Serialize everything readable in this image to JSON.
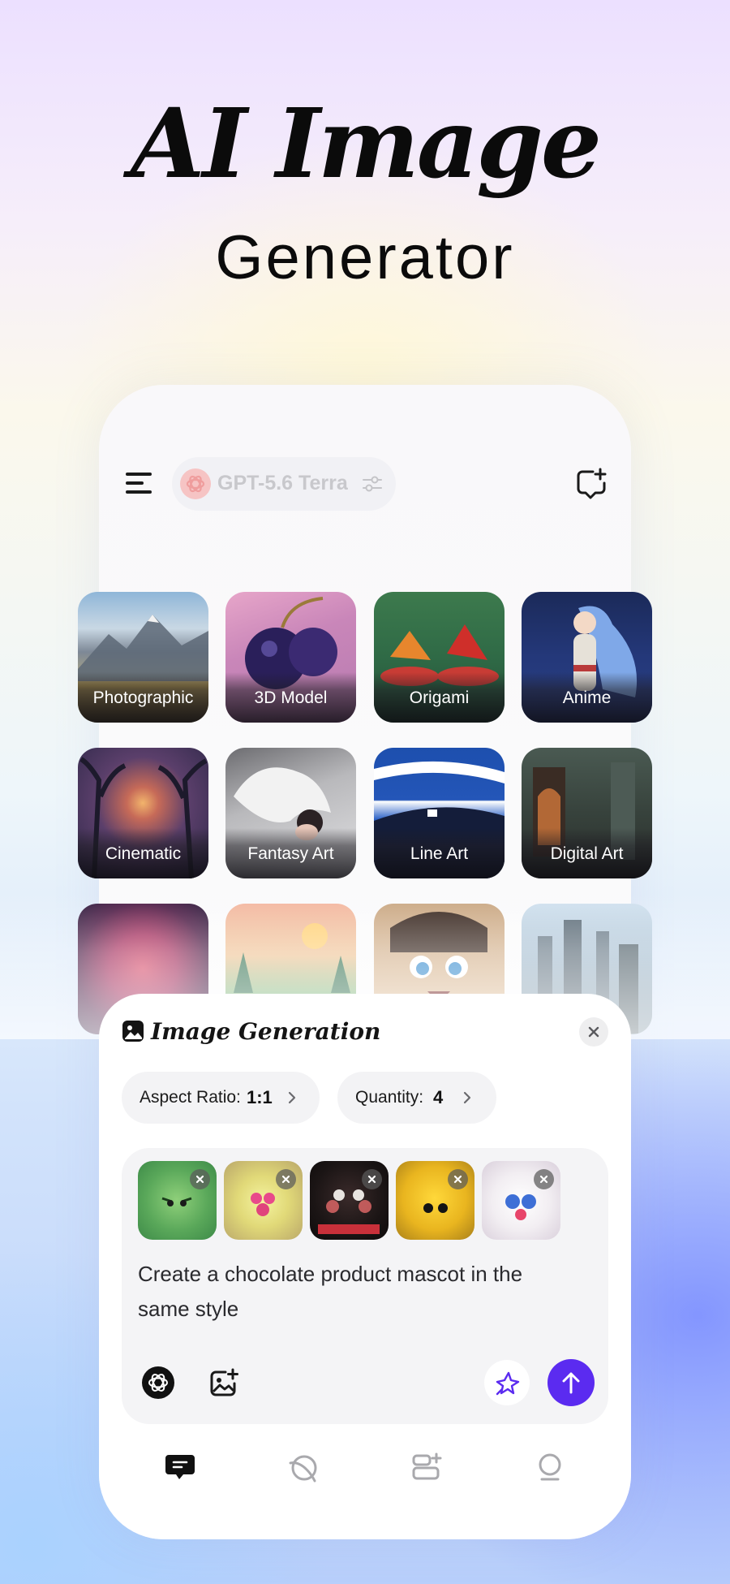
{
  "hero": {
    "title_line1": "AI Image",
    "title_line2": "Generator"
  },
  "top_bar": {
    "menu_icon": "menu-icon",
    "model_name": "GPT-5.6 Terra",
    "model_logo": "openai-logo-icon",
    "settings_icon": "tune-icon",
    "new_chat_icon": "new-chat-icon"
  },
  "styles": [
    {
      "label": "Photographic"
    },
    {
      "label": "3D Model"
    },
    {
      "label": "Origami"
    },
    {
      "label": "Anime"
    },
    {
      "label": "Cinematic"
    },
    {
      "label": "Fantasy Art"
    },
    {
      "label": "Line Art"
    },
    {
      "label": "Digital Art"
    },
    {
      "label": ""
    },
    {
      "label": ""
    },
    {
      "label": ""
    },
    {
      "label": ""
    }
  ],
  "sheet": {
    "title": "Image Generation",
    "aspect_label": "Aspect Ratio:",
    "aspect_value": "1:1",
    "quantity_label": "Quantity:",
    "quantity_value": "4",
    "reference_images": [
      {
        "name": "green-fluffy-mascot"
      },
      {
        "name": "yellow-fluffy-mascot"
      },
      {
        "name": "black-fluffy-mascot"
      },
      {
        "name": "orange-fluffy-mascot"
      },
      {
        "name": "white-fluffy-mascot"
      }
    ],
    "prompt": "Create a chocolate product mascot in the same style"
  },
  "colors": {
    "accent": "#5b2bf0",
    "text_dark": "#111111",
    "model_logo": "#f6c4c4"
  },
  "tab_bar": [
    "chat-icon",
    "explore-icon",
    "library-icon",
    "profile-icon"
  ]
}
